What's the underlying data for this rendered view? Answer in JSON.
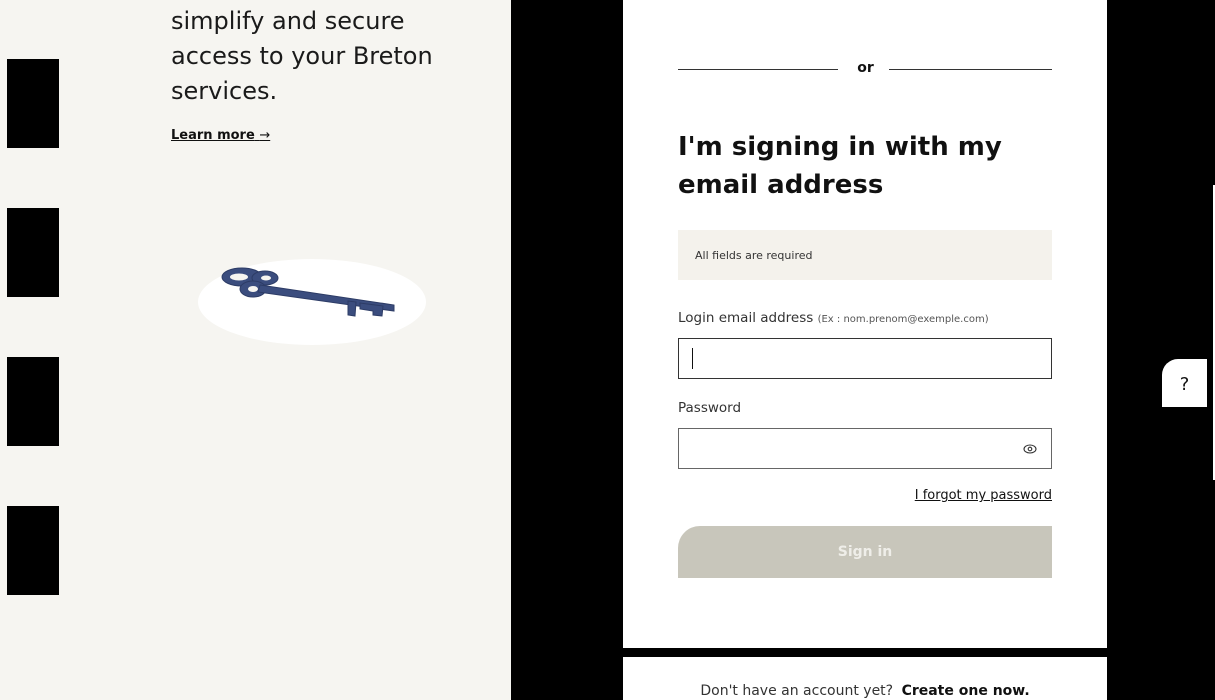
{
  "left_panel": {
    "pitch": "simplify and secure access to your Breton services.",
    "learn_more": "Learn more",
    "learn_more_arrow": "→"
  },
  "login_card": {
    "divider_text": "or",
    "title": "I'm signing in with my email address",
    "required_notice": "All fields are required",
    "email_label": "Login email address",
    "email_hint": "(Ex : nom.prenom@exemple.com)",
    "email_value": "",
    "password_label": "Password",
    "password_value": "",
    "forgot_password": "I forgot my password",
    "sign_in": "Sign in"
  },
  "account_prompt": {
    "text": "Don't have an account yet?",
    "create": "Create one now."
  },
  "help": {
    "label": "?"
  },
  "colors": {
    "left_bg": "#f6f5f1",
    "key_blue": "#3b4d7e",
    "button_disabled": "#c8c6bb",
    "notice_bg": "#f4f2ec"
  }
}
